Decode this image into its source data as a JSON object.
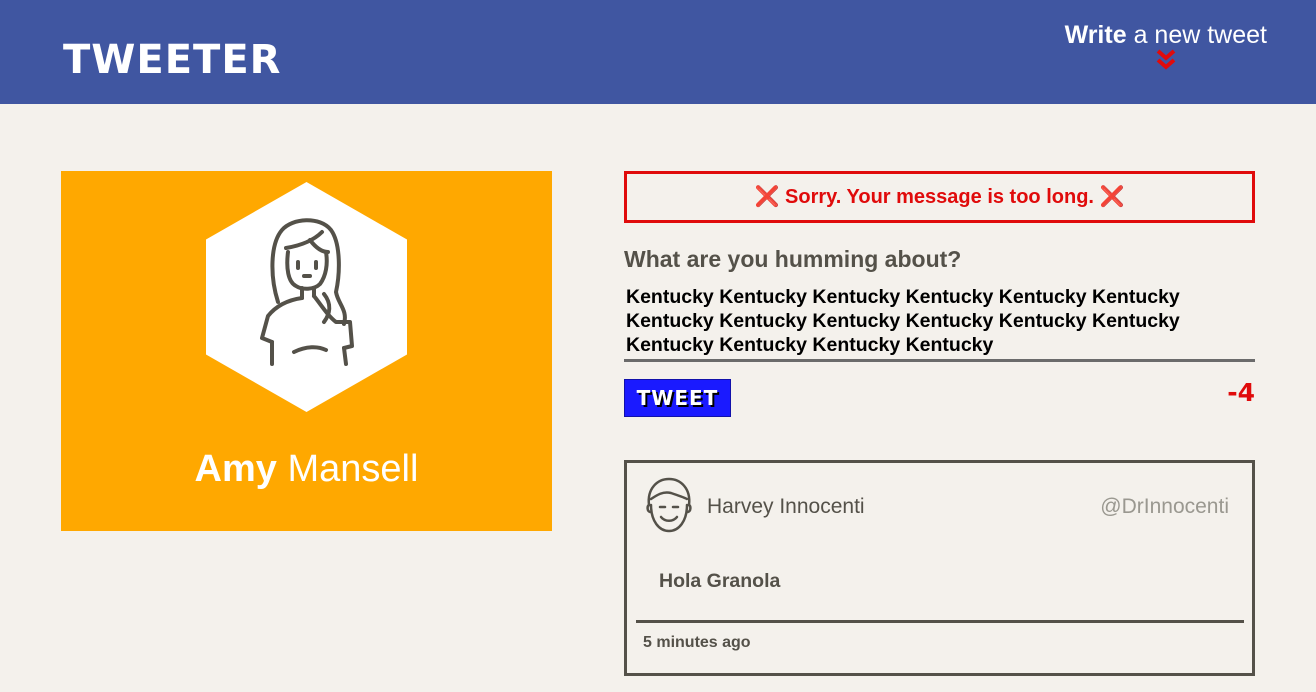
{
  "header": {
    "brand": "TWEETER",
    "compose_strong": "Write",
    "compose_light": "a new tweet",
    "compose_icon": "double-chevron-down-icon",
    "accent_color": "#e00b0b",
    "background_color": "#4056a1"
  },
  "profile": {
    "first_name": "Amy",
    "last_name": "Mansell",
    "avatar_icon": "woman-avatar-icon",
    "background_color": "#ffa800"
  },
  "compose": {
    "error_message": "❌ Sorry. Your message is too long. ❌",
    "prompt": "What are you humming about?",
    "text_value": "Kentucky Kentucky Kentucky Kentucky Kentucky Kentucky Kentucky Kentucky Kentucky Kentucky Kentucky Kentucky Kentucky Kentucky Kentucky Kentucky",
    "submit_label": "TWEET",
    "char_counter": "-4"
  },
  "tweets": [
    {
      "name": "Harvey Innocenti",
      "handle": "@DrInnocenti",
      "avatar_icon": "man-avatar-icon",
      "content": "Hola Granola",
      "time": "5 minutes ago"
    }
  ]
}
